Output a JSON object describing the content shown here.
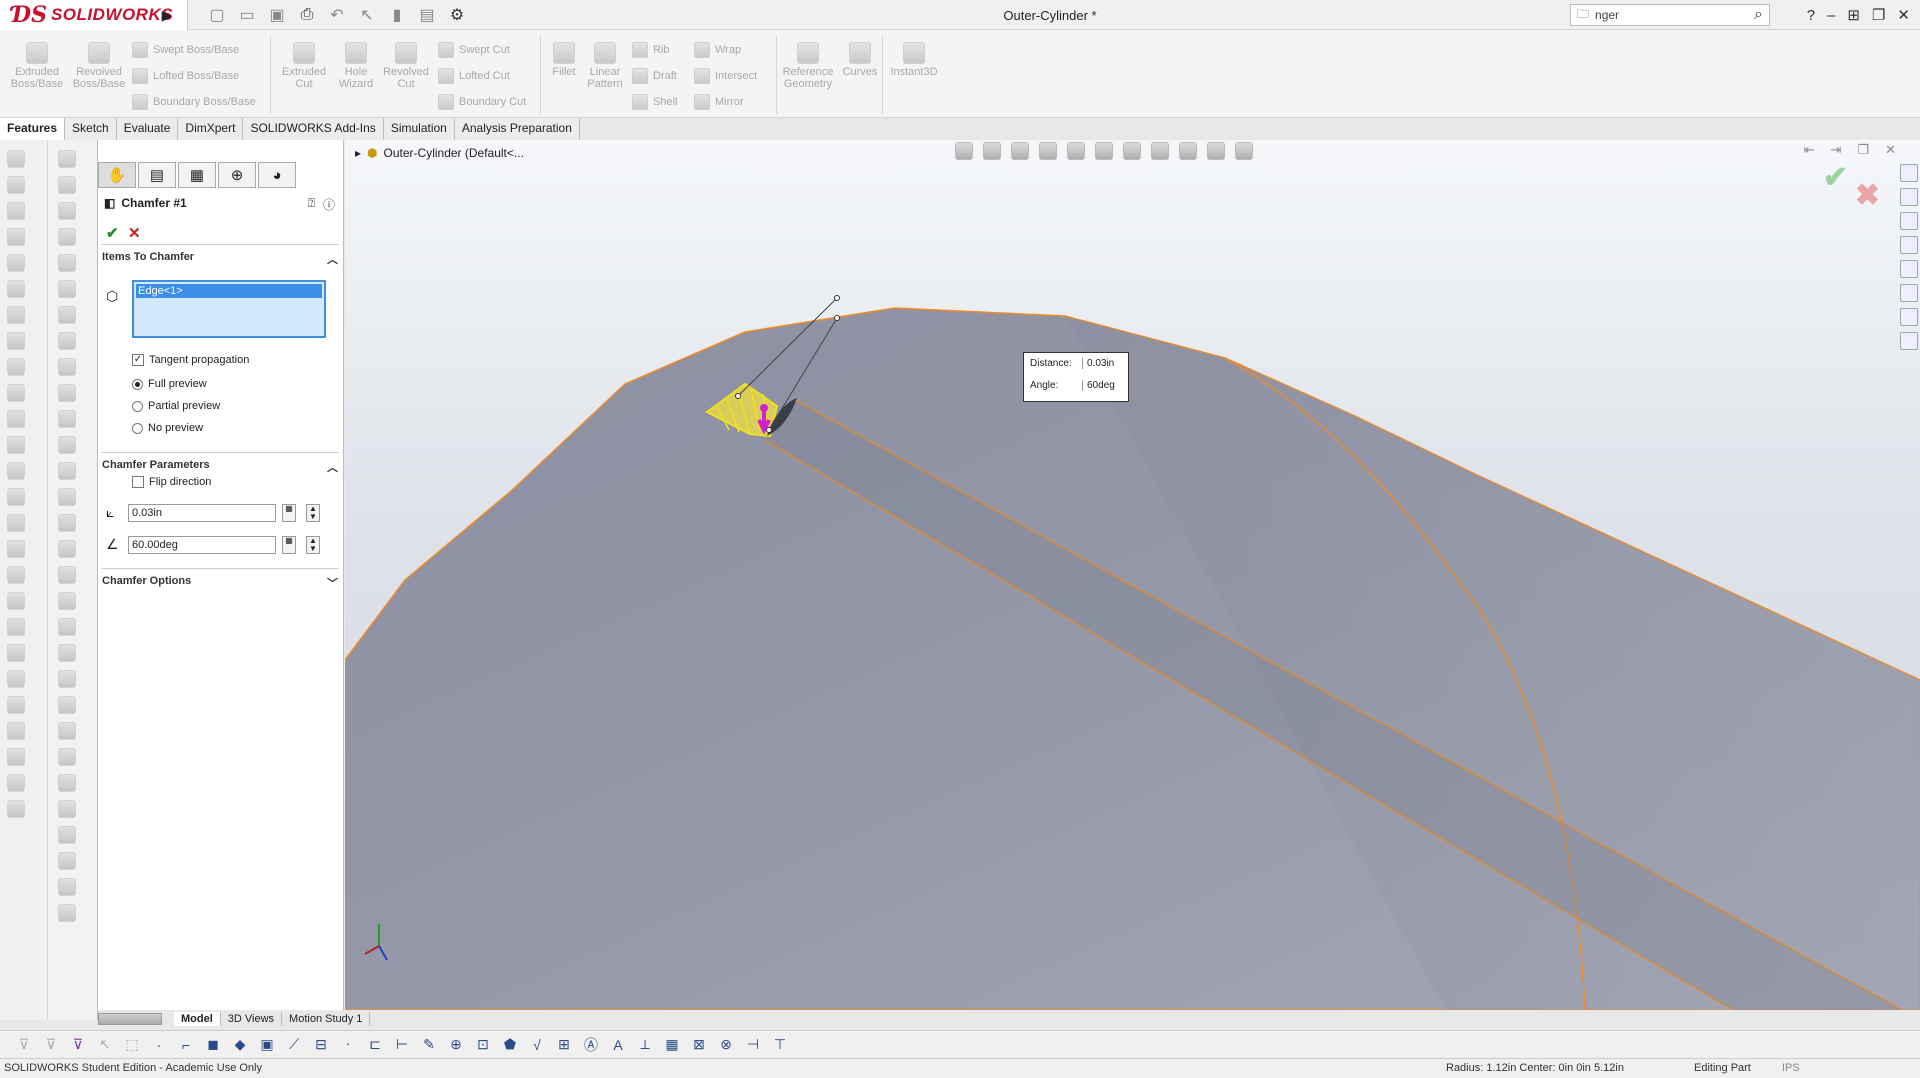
{
  "app": {
    "brand": "SOLIDWORKS",
    "document_title": "Outer-Cylinder *",
    "search_value": "nger",
    "help_label": "?"
  },
  "command_manager": {
    "tools": [
      {
        "label": "Extruded Boss/Base"
      },
      {
        "label": "Revolved Boss/Base"
      },
      {
        "label": "Extruded Cut"
      },
      {
        "label": "Hole Wizard"
      },
      {
        "label": "Revolved Cut"
      },
      {
        "label": "Fillet"
      },
      {
        "label": "Linear Pattern"
      },
      {
        "label": "Reference Geometry"
      },
      {
        "label": "Curves"
      },
      {
        "label": "Instant3D"
      }
    ],
    "small_tools": [
      {
        "label": "Swept Boss/Base"
      },
      {
        "label": "Lofted Boss/Base"
      },
      {
        "label": "Boundary Boss/Base"
      },
      {
        "label": "Swept Cut"
      },
      {
        "label": "Lofted Cut"
      },
      {
        "label": "Boundary Cut"
      },
      {
        "label": "Rib"
      },
      {
        "label": "Draft"
      },
      {
        "label": "Shell"
      },
      {
        "label": "Wrap"
      },
      {
        "label": "Intersect"
      },
      {
        "label": "Mirror"
      }
    ]
  },
  "tabs": [
    "Features",
    "Sketch",
    "Evaluate",
    "DimXpert",
    "SOLIDWORKS Add-Ins",
    "Simulation",
    "Analysis Preparation"
  ],
  "property_manager": {
    "title": "Chamfer #1",
    "sections": {
      "items": "Items To Chamfer",
      "params": "Chamfer Parameters",
      "options": "Chamfer Options"
    },
    "edge_selection": "Edge<1>",
    "tangent_propagation": {
      "label": "Tangent propagation",
      "checked": true
    },
    "preview": {
      "full": "Full preview",
      "partial": "Partial preview",
      "none": "No preview",
      "selected": "full"
    },
    "flip_direction": {
      "label": "Flip direction",
      "checked": false
    },
    "distance_value": "0.03in",
    "angle_value": "60.00deg"
  },
  "viewport": {
    "tree_root": "Outer-Cylinder  (Default<...",
    "callout": {
      "distance_label": "Distance:",
      "distance_value": "0.03in",
      "angle_label": "Angle:",
      "angle_value": "60deg"
    },
    "colors": {
      "edge": "#f08a24",
      "surface": "#8f93a3",
      "preview": "#f0e020",
      "handle": "#d020d0"
    }
  },
  "bottom_tabs": [
    "Model",
    "3D Views",
    "Motion Study 1"
  ],
  "status": {
    "left": "SOLIDWORKS Student Edition - Academic Use Only",
    "radius": "Radius: 1.12in  Center: 0in 0in 5.12in",
    "mode": "Editing Part",
    "units": "IPS"
  }
}
